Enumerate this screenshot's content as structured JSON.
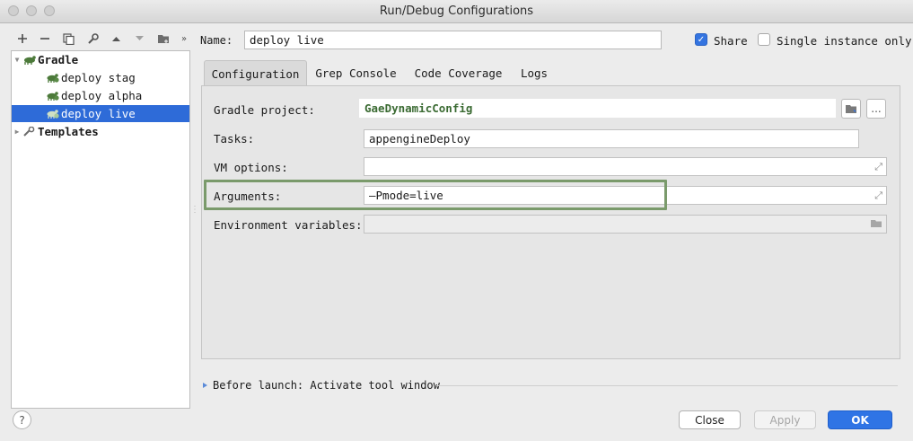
{
  "window": {
    "title": "Run/Debug Configurations"
  },
  "toolbar": {
    "icons": [
      "add-icon",
      "remove-icon",
      "copy-icon",
      "wrench-icon",
      "move-up-icon",
      "move-down-icon",
      "folder-icon",
      "more-icon"
    ]
  },
  "tree": {
    "root": {
      "label": "Gradle",
      "icon": "gradle-icon"
    },
    "items": [
      {
        "label": "deploy stag",
        "icon": "gradle-icon"
      },
      {
        "label": "deploy alpha",
        "icon": "gradle-icon"
      },
      {
        "label": "deploy live",
        "icon": "gradle-icon",
        "selected": true
      }
    ],
    "templates": {
      "label": "Templates",
      "icon": "wrench-icon"
    }
  },
  "name": {
    "label": "Name:",
    "value": "deploy live"
  },
  "share": {
    "label": "Share",
    "checked": true
  },
  "single_instance": {
    "label": "Single instance only",
    "checked": false
  },
  "tabs": [
    {
      "label": "Configuration",
      "active": true
    },
    {
      "label": "Grep Console"
    },
    {
      "label": "Code Coverage"
    },
    {
      "label": "Logs"
    }
  ],
  "form": {
    "gradle_project": {
      "label": "Gradle project:",
      "value": "GaeDynamicConfig"
    },
    "tasks": {
      "label": "Tasks:",
      "value": "appengineDeploy"
    },
    "vm_options": {
      "label": "VM options:",
      "value": ""
    },
    "arguments": {
      "label": "Arguments:",
      "value": "—Pmode=live"
    },
    "env_vars": {
      "label": "Environment variables:",
      "value": ""
    },
    "more_button": "..."
  },
  "before_launch": {
    "label": "Before launch: Activate tool window"
  },
  "buttons": {
    "help": "?",
    "close": "Close",
    "apply": "Apply",
    "ok": "OK"
  },
  "colors": {
    "accent": "#2e6bd8",
    "highlight_box": "#7a9a6b",
    "project_text": "#3b6b33"
  }
}
